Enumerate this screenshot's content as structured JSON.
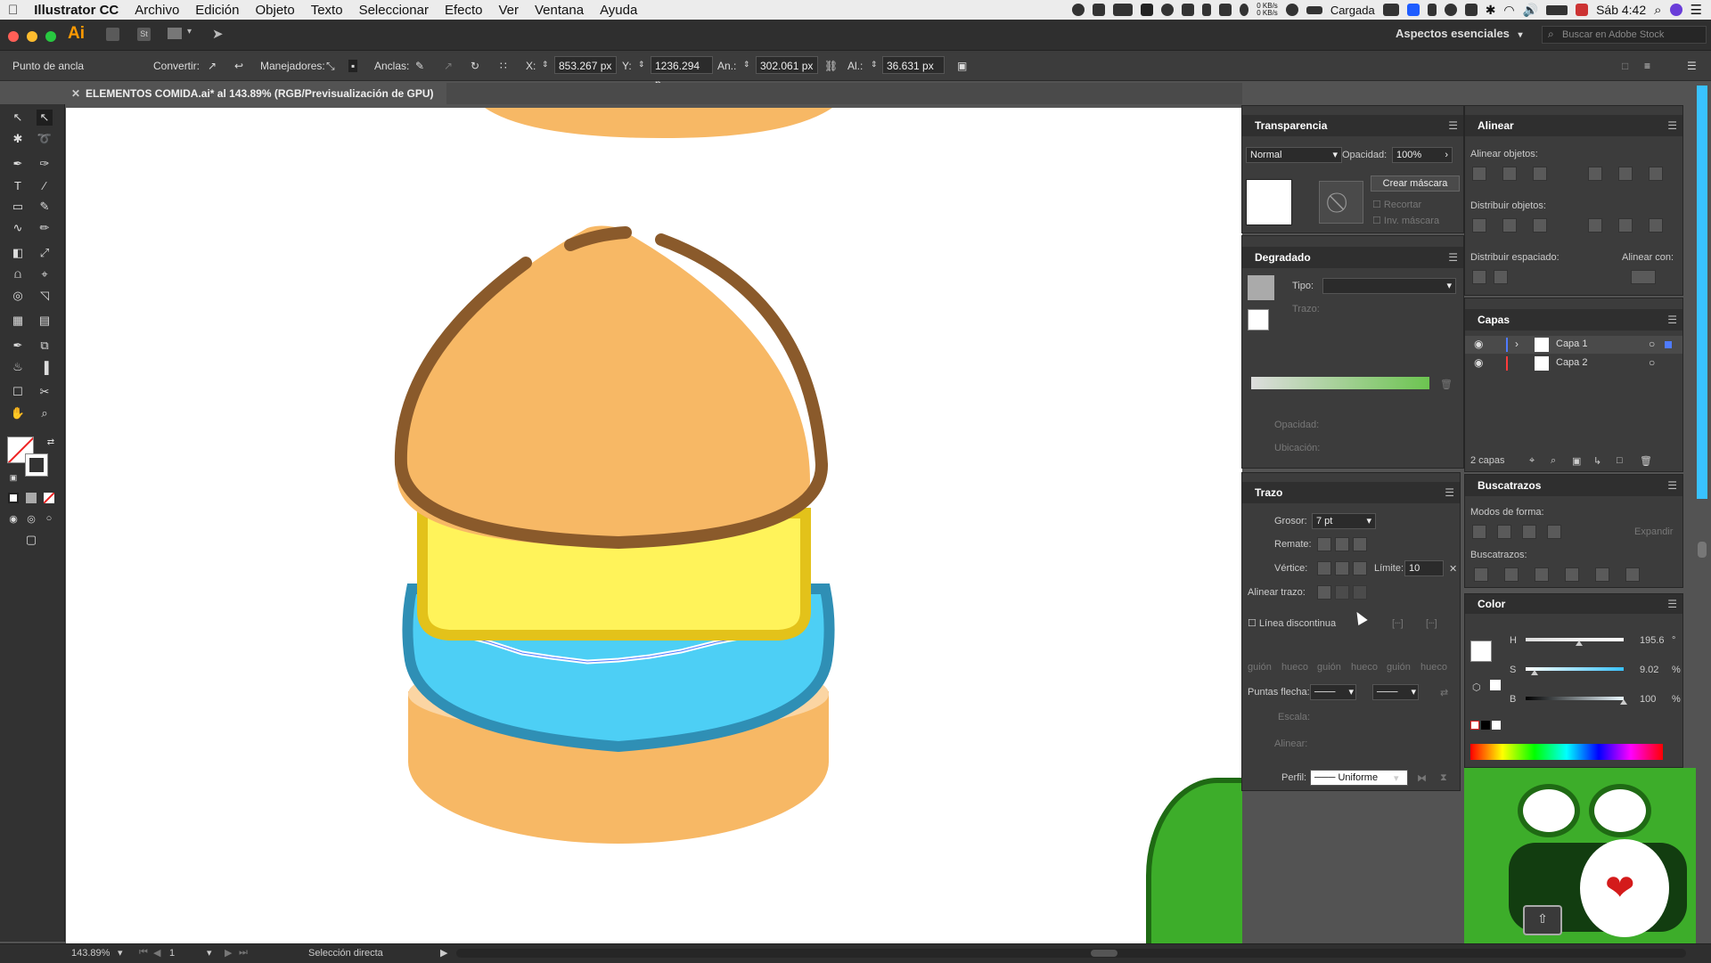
{
  "menubar": {
    "apple_icon": "apple-icon",
    "app_name": "Illustrator CC",
    "items": [
      "Archivo",
      "Edición",
      "Objeto",
      "Texto",
      "Seleccionar",
      "Efecto",
      "Ver",
      "Ventana",
      "Ayuda"
    ],
    "net_up": "0 KB/s",
    "net_down": "0 KB/s",
    "battery_status": "Cargada",
    "clock": "Sáb 4:42"
  },
  "appbar": {
    "logo": "Ai",
    "workspace": "Aspectos esenciales",
    "stock_search_placeholder": "Buscar en Adobe Stock"
  },
  "control": {
    "tool_label": "Punto de ancla",
    "convert_label": "Convertir:",
    "handles_label": "Manejadores:",
    "anchors_label": "Anclas:",
    "x_label": "X:",
    "x_value": "853.267 px",
    "y_label": "Y:",
    "y_value": "1236.294 p",
    "w_label": "An.:",
    "w_value": "302.061 px",
    "h_label": "Al.:",
    "h_value": "36.631 px"
  },
  "document": {
    "tab_title": "ELEMENTOS COMIDA.ai* al 143.89% (RGB/Previsualización de GPU)"
  },
  "transparency": {
    "title": "Transparencia",
    "mode": "Normal",
    "opacity_label": "Opacidad:",
    "opacity_value": "100%",
    "make_mask": "Crear máscara",
    "clip": "Recortar",
    "invert_mask": "Inv. máscara"
  },
  "gradient": {
    "title": "Degradado",
    "type_label": "Tipo:",
    "stroke_label": "Trazo:",
    "opacity_label": "Opacidad:",
    "location_label": "Ubicación:"
  },
  "stroke": {
    "title": "Trazo",
    "weight_label": "Grosor:",
    "weight_value": "7 pt",
    "cap_label": "Remate:",
    "corner_label": "Vértice:",
    "limit_label": "Límite:",
    "limit_value": "10",
    "align_label": "Alinear trazo:",
    "dashed_label": "Línea discontinua",
    "dash_labels": [
      "guión",
      "hueco",
      "guión",
      "hueco",
      "guión",
      "hueco"
    ],
    "arrowheads_label": "Puntas flecha:",
    "scale_label": "Escala:",
    "align2_label": "Alinear:",
    "profile_label": "Perfil:",
    "profile_value": "Uniforme"
  },
  "align": {
    "title": "Alinear",
    "align_objects": "Alinear objetos:",
    "distribute_objects": "Distribuir objetos:",
    "distribute_spacing": "Distribuir espaciado:",
    "align_to": "Alinear con:"
  },
  "layers": {
    "title": "Capas",
    "items": [
      {
        "name": "Capa 1",
        "color": "#4f7bff"
      },
      {
        "name": "Capa 2",
        "color": "#ff3b3b"
      }
    ],
    "count": "2 capas"
  },
  "pathfinder": {
    "title": "Buscatrazos",
    "shape_modes": "Modos de forma:",
    "expand": "Expandir",
    "pathfinders": "Buscatrazos:"
  },
  "color": {
    "title": "Color",
    "h_label": "H",
    "h_value": "195.6",
    "h_unit": "°",
    "h_fraction": 0.543,
    "s_label": "S",
    "s_value": "9.02",
    "s_unit": "%",
    "s_fraction": 0.09,
    "b_label": "B",
    "b_value": "100",
    "b_unit": "%",
    "b_fraction": 1.0
  },
  "status": {
    "zoom": "143.89%",
    "artboard": "1",
    "tool": "Selección directa"
  },
  "colors": {
    "bun_fill": "#f7b865",
    "bun_stroke": "#8a5a2b",
    "cheese": "#fff35a",
    "cheese_edge": "#e3c21a",
    "filling": "#4dcff5",
    "filling_edge": "#2f8fb5",
    "base": "#f7b865",
    "base_light": "#fbd5a3",
    "accent_blue": "#39c2ff",
    "frog_green": "#3dad2a"
  }
}
